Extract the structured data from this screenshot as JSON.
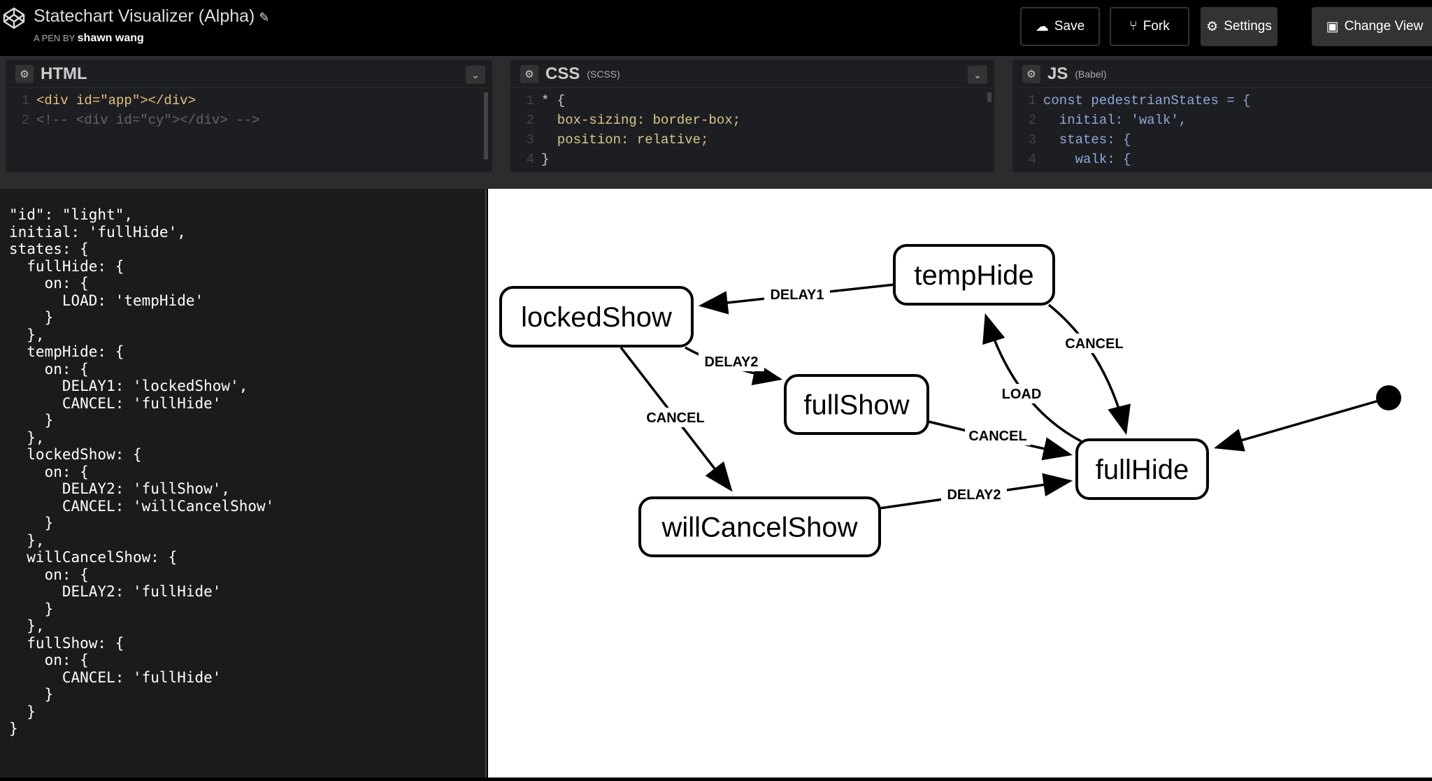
{
  "header": {
    "title": "Statechart Visualizer (Alpha)",
    "byline_prefix": "A PEN BY",
    "author": "shawn wang",
    "buttons": [
      {
        "label": "Save",
        "icon": "cloud-icon"
      },
      {
        "label": "Fork",
        "icon": "fork-icon"
      },
      {
        "label": "Settings",
        "icon": "gear-icon"
      },
      {
        "label": "Change View",
        "icon": "layout-icon"
      }
    ]
  },
  "editors": [
    {
      "name": "HTML",
      "sub": "",
      "lines": [
        "<div id=\"app\"></div>",
        "<!-- <div id=\"cy\"></div> -->"
      ]
    },
    {
      "name": "CSS",
      "sub": "(SCSS)",
      "lines": [
        "* {",
        "  box-sizing: border-box;",
        "  position: relative;",
        "}"
      ]
    },
    {
      "name": "JS",
      "sub": "(Babel)",
      "lines": [
        "const pedestrianStates = {",
        "  initial: 'walk',",
        "  states: {",
        "    walk: {"
      ]
    }
  ],
  "config_text": "\"id\": \"light\",\ninitial: 'fullHide',\nstates: {\n  fullHide: {\n    on: {\n      LOAD: 'tempHide'\n    }\n  },\n  tempHide: {\n    on: {\n      DELAY1: 'lockedShow',\n      CANCEL: 'fullHide'\n    }\n  },\n  lockedShow: {\n    on: {\n      DELAY2: 'fullShow',\n      CANCEL: 'willCancelShow'\n    }\n  },\n  willCancelShow: {\n    on: {\n      DELAY2: 'fullHide'\n    }\n  },\n  fullShow: {\n    on: {\n      CANCEL: 'fullHide'\n    }\n  }\n}",
  "statechart": {
    "initial": "fullHide",
    "states": [
      "tempHide",
      "lockedShow",
      "fullShow",
      "fullHide",
      "willCancelShow"
    ],
    "transitions": [
      {
        "from": "tempHide",
        "to": "lockedShow",
        "event": "DELAY1"
      },
      {
        "from": "lockedShow",
        "to": "fullShow",
        "event": "DELAY2"
      },
      {
        "from": "lockedShow",
        "to": "willCancelShow",
        "event": "CANCEL"
      },
      {
        "from": "fullShow",
        "to": "fullHide",
        "event": "CANCEL"
      },
      {
        "from": "willCancelShow",
        "to": "fullHide",
        "event": "DELAY2"
      },
      {
        "from": "tempHide",
        "to": "fullHide",
        "event": "CANCEL"
      },
      {
        "from": "fullHide",
        "to": "tempHide",
        "event": "LOAD"
      }
    ]
  }
}
